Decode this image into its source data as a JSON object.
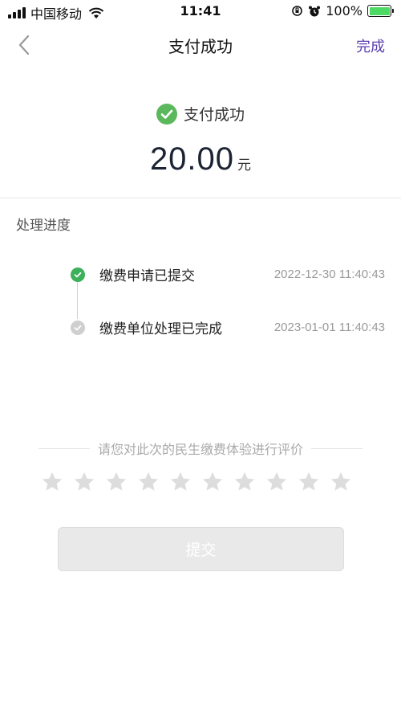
{
  "status_bar": {
    "carrier": "中国移动",
    "time": "11:41",
    "battery_percent": "100%"
  },
  "nav": {
    "title": "支付成功",
    "done_label": "完成"
  },
  "payment": {
    "status_text": "支付成功",
    "amount": "20.00",
    "currency_unit": "元"
  },
  "progress": {
    "title": "处理进度",
    "steps": [
      {
        "label": "缴费申请已提交",
        "time": "2022-12-30 11:40:43",
        "status": "done",
        "color": "#3db05a"
      },
      {
        "label": "缴费单位处理已完成",
        "time": "2023-01-01 11:40:43",
        "status": "pending",
        "color": "#cfcfcf"
      }
    ]
  },
  "rating": {
    "prompt": "请您对此次的民生缴费体验进行评价",
    "max_stars": 10,
    "selected": 0,
    "star_color": "#dddddd"
  },
  "submit_label": "提交",
  "colors": {
    "accent": "#5b3fb0",
    "success": "#4caf50"
  }
}
